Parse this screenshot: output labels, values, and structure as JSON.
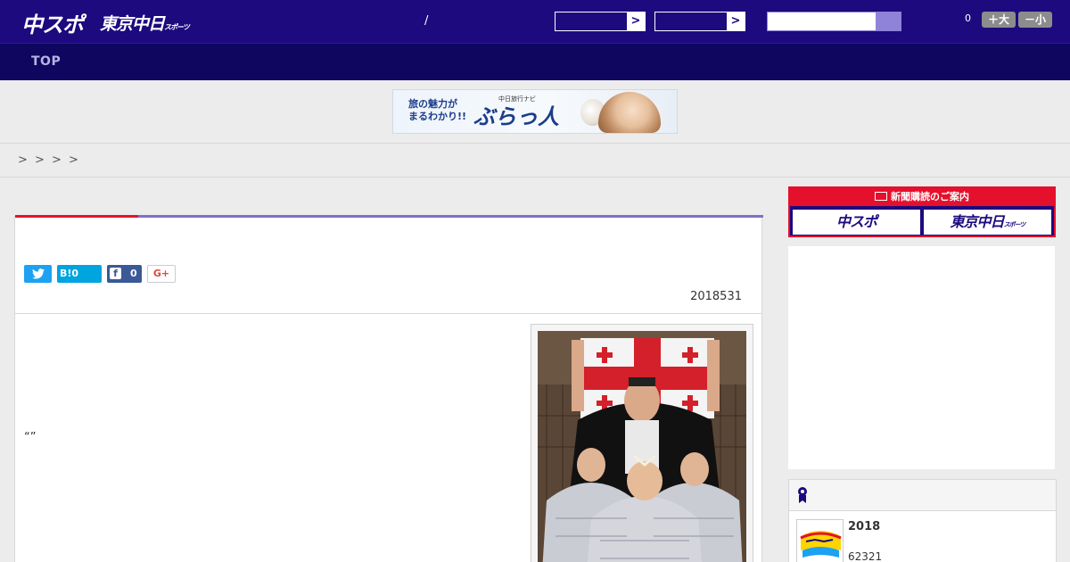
{
  "header": {
    "logo_main": "中スポ",
    "logo_sub": "東京中日",
    "logo_sub_small": "スポーツ",
    "slash": "/",
    "select_arrow": ">",
    "font_count": "0",
    "font_bigger": "＋大",
    "font_smaller": "－小"
  },
  "nav": {
    "top_label": "TOP"
  },
  "banner": {
    "line1": "旅の魅力が",
    "line2": "まるわかり!!",
    "brand_sub": "中日旅行ナビ",
    "brand": "ぶらっ人"
  },
  "breadcrumb": {
    "separators": [
      ">",
      ">",
      ">",
      ">"
    ]
  },
  "article": {
    "share": {
      "hatena_label": "B!0",
      "facebook_icon": "f",
      "facebook_count": "0",
      "googleplus_label": "G+"
    },
    "date": "2018531",
    "quote": "“”"
  },
  "sidebar": {
    "subscribe_header": "新聞購読のご案内",
    "subscribe_chuspo": "中スポ",
    "subscribe_tokyo": "東京中日",
    "subscribe_tokyo_small": "スポーツ",
    "ranking": {
      "title": "2018",
      "number": "62321"
    }
  },
  "colors": {
    "header_bg": "#1c0a7e",
    "nav_bg": "#0f0660",
    "accent_red": "#e4102c",
    "accent_purple": "#7a72c8",
    "twitter": "#1da1f2",
    "hatena": "#00a4de",
    "facebook": "#3b5998"
  },
  "icons": {
    "twitter": "twitter-icon",
    "facebook": "facebook-icon",
    "newspaper": "newspaper-icon",
    "ranking": "ribbon-icon"
  }
}
